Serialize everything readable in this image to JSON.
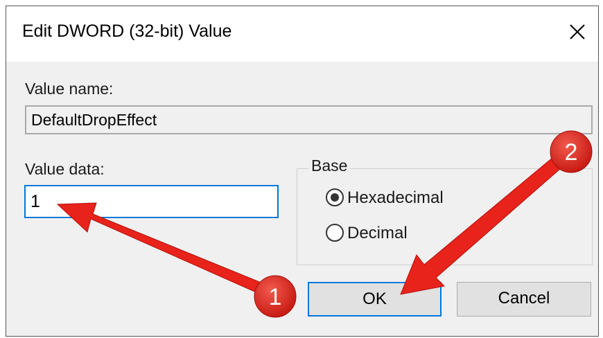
{
  "window": {
    "title": "Edit DWORD (32-bit) Value",
    "close_icon": "close-icon"
  },
  "form": {
    "value_name_label": "Value name:",
    "value_name": "DefaultDropEffect",
    "value_data_label": "Value data:",
    "value_data": "1"
  },
  "base": {
    "title": "Base",
    "options": [
      {
        "label": "Hexadecimal",
        "selected": true
      },
      {
        "label": "Decimal",
        "selected": false
      }
    ]
  },
  "buttons": {
    "ok": "OK",
    "cancel": "Cancel"
  },
  "annotations": {
    "marker_1": "1",
    "marker_2": "2",
    "color": "#e8231b"
  }
}
